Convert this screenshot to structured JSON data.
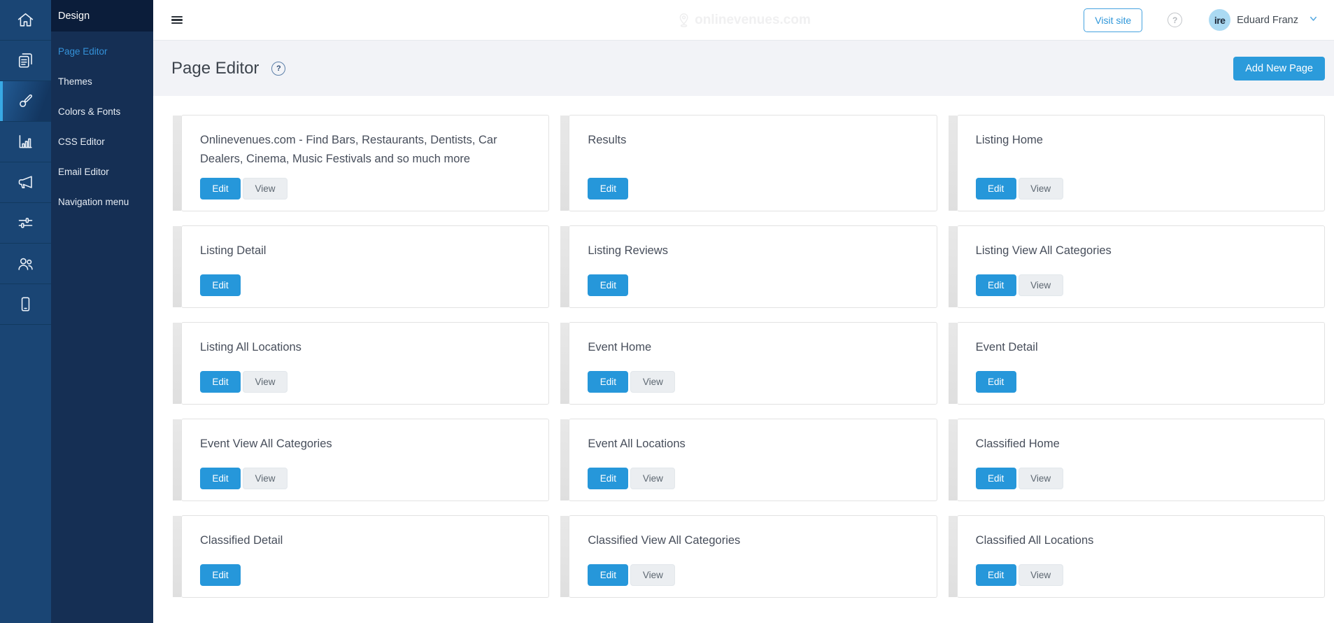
{
  "rail": {
    "active_index": 2,
    "items": [
      {
        "name": "home",
        "icon": "home-icon"
      },
      {
        "name": "pages",
        "icon": "pages-icon"
      },
      {
        "name": "design",
        "icon": "paintbrush-icon"
      },
      {
        "name": "reports",
        "icon": "bar-chart-icon"
      },
      {
        "name": "promote",
        "icon": "megaphone-icon"
      },
      {
        "name": "settings",
        "icon": "sliders-icon"
      },
      {
        "name": "members",
        "icon": "users-icon"
      },
      {
        "name": "mobile",
        "icon": "mobile-icon"
      }
    ]
  },
  "submenu": {
    "title": "Design",
    "items": [
      {
        "label": "Page Editor",
        "active": true
      },
      {
        "label": "Themes",
        "active": false
      },
      {
        "label": "Colors & Fonts",
        "active": false
      },
      {
        "label": "CSS Editor",
        "active": false
      },
      {
        "label": "Email Editor",
        "active": false
      },
      {
        "label": "Navigation menu",
        "active": false
      }
    ]
  },
  "topbar": {
    "logo_text": "onlinevenues.com",
    "logo_icon": "map-pin-icon",
    "visit_site_label": "Visit site",
    "help_label": "?",
    "avatar_text": "ire",
    "user_name": "Eduard Franz"
  },
  "page_header": {
    "title": "Page Editor",
    "help_label": "?",
    "add_button_label": "Add New Page"
  },
  "labels": {
    "edit": "Edit",
    "view": "View"
  },
  "cards": [
    {
      "title": "Onlinevenues.com - Find Bars, Restaurants, Dentists, Car Dealers, Cinema, Music Festivals and so much more",
      "view": true
    },
    {
      "title": "Results",
      "view": false
    },
    {
      "title": "Listing Home",
      "view": true
    },
    {
      "title": "Listing Detail",
      "view": false
    },
    {
      "title": "Listing Reviews",
      "view": false
    },
    {
      "title": "Listing View All Categories",
      "view": true
    },
    {
      "title": "Listing All Locations",
      "view": true
    },
    {
      "title": "Event Home",
      "view": true
    },
    {
      "title": "Event Detail",
      "view": false
    },
    {
      "title": "Event View All Categories",
      "view": true
    },
    {
      "title": "Event All Locations",
      "view": true
    },
    {
      "title": "Classified Home",
      "view": true
    },
    {
      "title": "Classified Detail",
      "view": false
    },
    {
      "title": "Classified View All Categories",
      "view": true
    },
    {
      "title": "Classified All Locations",
      "view": true
    }
  ],
  "colors": {
    "accent_blue": "#2697da",
    "rail_bg": "#1a4574",
    "rail_active_accent": "#38a9e5",
    "submenu_bg": "#152f54",
    "submenu_header_bg": "#0b1d3a",
    "active_link": "#3491d8",
    "band_bg": "#f2f3f7",
    "view_button_bg": "#ebeef1",
    "avatar_bg": "#abdaf3"
  }
}
